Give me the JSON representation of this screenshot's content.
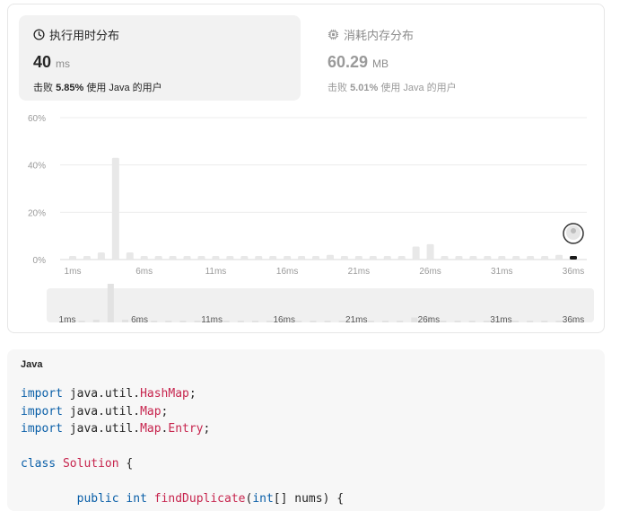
{
  "runtime": {
    "title": "执行用时分布",
    "value": "40",
    "unit": "ms",
    "beats_prefix": "击败",
    "beats_percent": "5.85%",
    "beats_suffix": "使用 Java 的用户"
  },
  "memory": {
    "title": "消耗内存分布",
    "value": "60.29",
    "unit": "MB",
    "beats_prefix": "击败",
    "beats_percent": "5.01%",
    "beats_suffix": "使用 Java 的用户"
  },
  "chart_data": {
    "type": "bar",
    "y_ticks": [
      "60%",
      "40%",
      "20%",
      "0%"
    ],
    "ylim": [
      0,
      60
    ],
    "x_tick_labels": [
      "1ms",
      "6ms",
      "11ms",
      "16ms",
      "21ms",
      "26ms",
      "31ms",
      "36ms"
    ],
    "categories": [
      "1ms",
      "2ms",
      "3ms",
      "4ms",
      "5ms",
      "6ms",
      "7ms",
      "8ms",
      "9ms",
      "10ms",
      "11ms",
      "12ms",
      "13ms",
      "14ms",
      "15ms",
      "16ms",
      "17ms",
      "18ms",
      "19ms",
      "20ms",
      "21ms",
      "22ms",
      "23ms",
      "24ms",
      "25ms",
      "26ms",
      "27ms",
      "28ms",
      "29ms",
      "30ms",
      "31ms",
      "32ms",
      "33ms",
      "34ms",
      "35ms",
      "36ms"
    ],
    "values": [
      1.5,
      1.5,
      3.0,
      43.0,
      3.0,
      1.5,
      1.5,
      1.5,
      1.5,
      1.5,
      1.5,
      1.5,
      1.5,
      1.5,
      1.5,
      1.5,
      1.5,
      1.5,
      2.0,
      1.5,
      1.5,
      1.5,
      1.5,
      1.5,
      5.5,
      6.5,
      1.5,
      1.5,
      1.5,
      1.5,
      1.5,
      1.5,
      1.5,
      1.5,
      2.0,
      1.5
    ],
    "highlight_category": "36ms",
    "grid": true
  },
  "code": {
    "language": "Java",
    "lines": [
      "import java.util.HashMap;",
      "import java.util.Map;",
      "import java.util.Map.Entry;",
      "",
      "class Solution {",
      "",
      "        public int findDuplicate(int[] nums) {"
    ]
  }
}
